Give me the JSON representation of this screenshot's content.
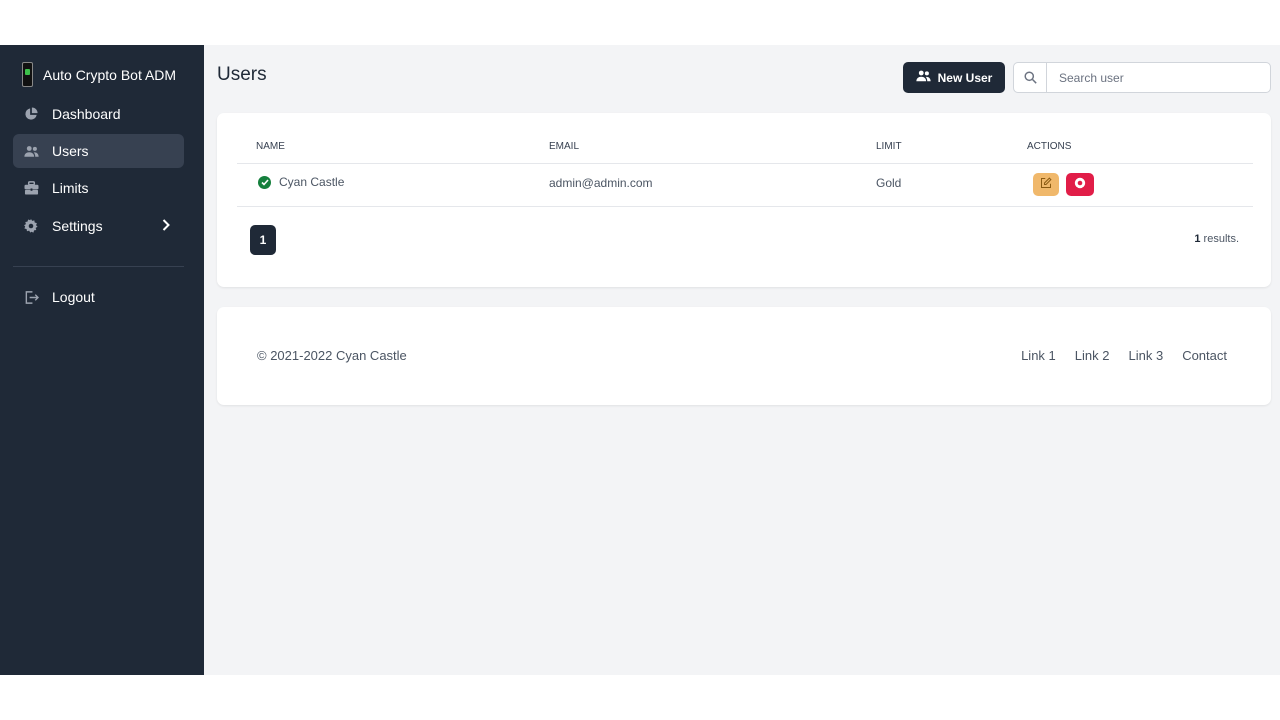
{
  "brand": {
    "name": "Auto Crypto Bot ADM"
  },
  "sidebar": {
    "items": [
      {
        "label": "Dashboard",
        "icon": "pie-chart-icon"
      },
      {
        "label": "Users",
        "icon": "users-icon",
        "active": true
      },
      {
        "label": "Limits",
        "icon": "briefcase-icon"
      },
      {
        "label": "Settings",
        "icon": "gear-icon"
      }
    ],
    "logout": "Logout"
  },
  "header": {
    "title": "Users",
    "new_user_label": "New User",
    "search_placeholder": "Search user"
  },
  "table": {
    "columns": [
      "NAME",
      "EMAIL",
      "LIMIT",
      "ACTIONS"
    ],
    "rows": [
      {
        "name": "Cyan Castle",
        "email": "admin@admin.com",
        "limit": "Gold"
      }
    ]
  },
  "pagination": {
    "current_page": "1",
    "results_count": "1",
    "results_label": " results."
  },
  "footer": {
    "copyright": "© 2021-2022 Cyan Castle",
    "links": [
      "Link 1",
      "Link 2",
      "Link 3",
      "Contact"
    ]
  },
  "colors": {
    "sidebar_bg": "#1f2937",
    "edit_button": "#f0b86b",
    "delete_button": "#e11d48",
    "status_ok": "#15803d"
  }
}
